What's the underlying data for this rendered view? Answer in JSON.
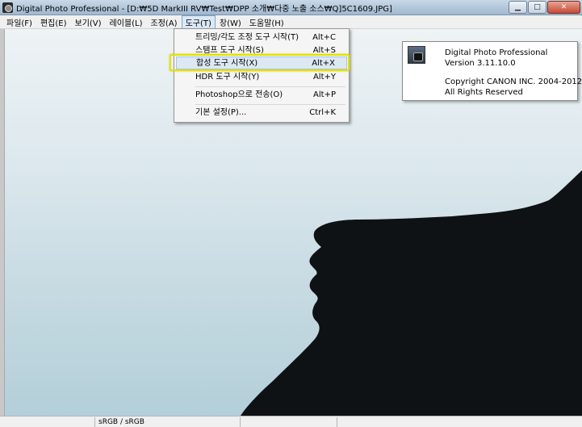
{
  "window": {
    "title": "Digital Photo Professional - [D:₩5D MarkIII RV₩Test₩DPP 소개₩다중 노출 소스₩Q]5C1609.JPG]",
    "app_icon": "dpp-app-icon",
    "buttons": {
      "minimize": "▁",
      "maximize": "□",
      "close": "✕"
    }
  },
  "menubar": {
    "items": [
      {
        "label": "파일(F)"
      },
      {
        "label": "편집(E)"
      },
      {
        "label": "보기(V)"
      },
      {
        "label": "레이블(L)"
      },
      {
        "label": "조정(A)"
      },
      {
        "label": "도구(T)",
        "active": true
      },
      {
        "label": "창(W)"
      },
      {
        "label": "도움말(H)"
      }
    ]
  },
  "tools_menu": {
    "items": [
      {
        "label": "트리밍/각도 조정 도구 시작(T)",
        "shortcut": "Alt+C"
      },
      {
        "label": "스탬프 도구 시작(S)",
        "shortcut": "Alt+S"
      },
      {
        "label": "합성 도구 시작(X)",
        "shortcut": "Alt+X",
        "selected": true
      },
      {
        "label": "HDR 도구 시작(Y)",
        "shortcut": "Alt+Y"
      },
      {
        "label": "Photoshop으로 전송(O)",
        "shortcut": "Alt+P"
      },
      {
        "label": "기본 설정(P)...",
        "shortcut": "Ctrl+K"
      }
    ],
    "highlight_color": "#e6e000"
  },
  "about": {
    "product": "Digital Photo Professional",
    "version": "Version 3.11.10.0",
    "copyright": "Copyright CANON INC. 2004-2012",
    "rights": "All Rights Reserved"
  },
  "statusbar": {
    "color_space": "sRGB / sRGB"
  },
  "colors": {
    "sky_top": "#eef3f5",
    "sky_bottom": "#b3cfd9",
    "silhouette": "#0e1214"
  }
}
